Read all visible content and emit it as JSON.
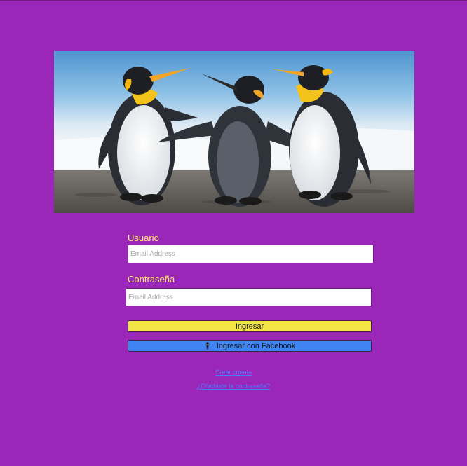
{
  "hero": {
    "image": "penguins-photo"
  },
  "form": {
    "username_label": "Usuario",
    "username_placeholder": "Email Address",
    "password_label": "Contraseña",
    "password_placeholder": "Email Address"
  },
  "buttons": {
    "login_label": "Ingresar",
    "facebook_label": "Ingresar con Facebook",
    "facebook_icon": "person-icon"
  },
  "links": {
    "create_account": "Crear cuenta",
    "forgot_password": "¿Olvidaste la contraseña?"
  },
  "colors": {
    "background": "#9a27b8",
    "label": "#ffec6b",
    "primary_button": "#f4e547",
    "facebook_button": "#3f84f0",
    "link": "#4a7cff"
  }
}
